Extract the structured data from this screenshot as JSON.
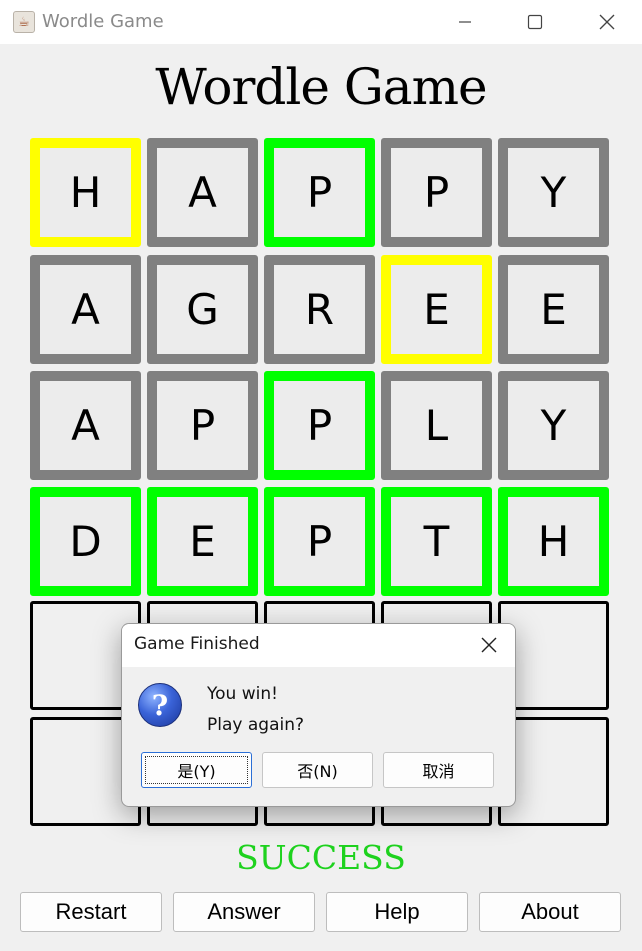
{
  "window": {
    "title": "Wordle Game",
    "icon": "java-cup-icon"
  },
  "heading": "Wordle Game",
  "colors": {
    "green": "#00ff00",
    "yellow": "#ffff00",
    "gray": "#808080",
    "empty_border": "#000000",
    "success_text": "#1ed21e"
  },
  "board": {
    "rows": [
      [
        {
          "letter": "H",
          "state": "yellow"
        },
        {
          "letter": "A",
          "state": "gray"
        },
        {
          "letter": "P",
          "state": "green"
        },
        {
          "letter": "P",
          "state": "gray"
        },
        {
          "letter": "Y",
          "state": "gray"
        }
      ],
      [
        {
          "letter": "A",
          "state": "gray"
        },
        {
          "letter": "G",
          "state": "gray"
        },
        {
          "letter": "R",
          "state": "gray"
        },
        {
          "letter": "E",
          "state": "yellow"
        },
        {
          "letter": "E",
          "state": "gray"
        }
      ],
      [
        {
          "letter": "A",
          "state": "gray"
        },
        {
          "letter": "P",
          "state": "gray"
        },
        {
          "letter": "P",
          "state": "green"
        },
        {
          "letter": "L",
          "state": "gray"
        },
        {
          "letter": "Y",
          "state": "gray"
        }
      ],
      [
        {
          "letter": "D",
          "state": "green"
        },
        {
          "letter": "E",
          "state": "green"
        },
        {
          "letter": "P",
          "state": "green"
        },
        {
          "letter": "T",
          "state": "green"
        },
        {
          "letter": "H",
          "state": "green"
        }
      ],
      [
        {
          "letter": "",
          "state": "empty"
        },
        {
          "letter": "",
          "state": "empty"
        },
        {
          "letter": "",
          "state": "empty"
        },
        {
          "letter": "",
          "state": "empty"
        },
        {
          "letter": "",
          "state": "empty"
        }
      ],
      [
        {
          "letter": "",
          "state": "empty"
        },
        {
          "letter": "",
          "state": "empty"
        },
        {
          "letter": "",
          "state": "empty"
        },
        {
          "letter": "",
          "state": "empty"
        },
        {
          "letter": "",
          "state": "empty"
        }
      ]
    ]
  },
  "status": "SUCCESS",
  "buttons": {
    "restart": "Restart",
    "answer": "Answer",
    "help": "Help",
    "about": "About"
  },
  "dialog": {
    "title": "Game Finished",
    "icon": "question-icon",
    "message_line1": "You win!",
    "message_line2": "Play again?",
    "yes": "是(Y)",
    "no": "否(N)",
    "cancel": "取消"
  }
}
